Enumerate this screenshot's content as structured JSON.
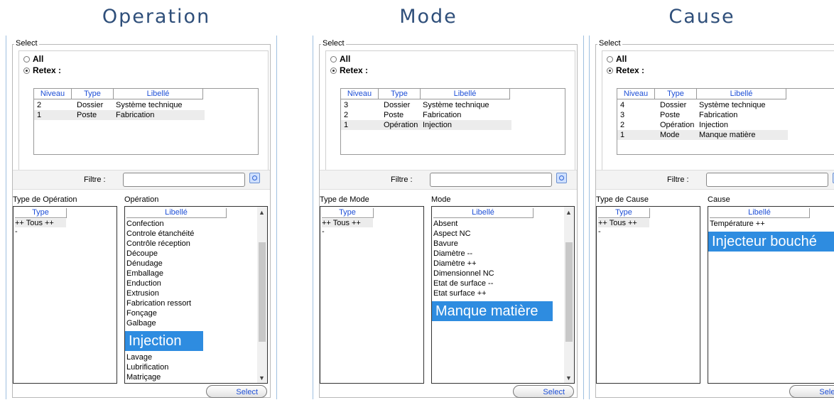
{
  "headings": [
    "Operation",
    "Mode",
    "Cause"
  ],
  "panels": [
    {
      "select_legend": "Select",
      "radio_all": "All",
      "radio_retex": "Retex :",
      "list_columns": [
        "Niveau",
        "Type",
        "Libellé"
      ],
      "list_rows": [
        {
          "niveau": "2",
          "type": "Dossier",
          "libelle": "Système technique"
        },
        {
          "niveau": "1",
          "type": "Poste",
          "libelle": "Fabrication"
        }
      ],
      "filter_label": "Filtre :",
      "type_label": "Type de Opération",
      "main_label": "Opération",
      "type_col": "Type",
      "type_items": [
        "++ Tous ++",
        "-"
      ],
      "main_col": "Libellé",
      "main_items": [
        "Confection",
        "Controle étanchéité",
        "Contrôle réception",
        "Découpe",
        "Dénudage",
        "Emballage",
        "Enduction",
        "Extrusion",
        "Fabrication ressort",
        "Fonçage",
        "Galbage"
      ],
      "highlight": "Injection",
      "after_items": [
        "Lavage",
        "Lubrification",
        "Matriçage"
      ],
      "select_button": "Select"
    },
    {
      "select_legend": "Select",
      "radio_all": "All",
      "radio_retex": "Retex :",
      "list_columns": [
        "Niveau",
        "Type",
        "Libellé"
      ],
      "list_rows": [
        {
          "niveau": "3",
          "type": "Dossier",
          "libelle": "Système technique"
        },
        {
          "niveau": "2",
          "type": "Poste",
          "libelle": "Fabrication"
        },
        {
          "niveau": "1",
          "type": "Opération",
          "libelle": "Injection"
        }
      ],
      "filter_label": "Filtre :",
      "type_label": "Type de Mode",
      "main_label": "Mode",
      "type_col": "Type",
      "type_items": [
        "++ Tous ++",
        "-"
      ],
      "main_col": "Libellé",
      "main_items": [
        "Absent",
        "Aspect NC",
        "Bavure",
        "Diamètre --",
        "Diamètre ++",
        "Dimensionnel NC",
        "Etat de surface --",
        "Etat surface ++"
      ],
      "highlight": "Manque matière",
      "after_items": [],
      "select_button": "Select"
    },
    {
      "select_legend": "Select",
      "radio_all": "All",
      "radio_retex": "Retex :",
      "list_columns": [
        "Niveau",
        "Type",
        "Libellé"
      ],
      "list_rows": [
        {
          "niveau": "4",
          "type": "Dossier",
          "libelle": "Système technique"
        },
        {
          "niveau": "3",
          "type": "Poste",
          "libelle": "Fabrication"
        },
        {
          "niveau": "2",
          "type": "Opération",
          "libelle": "Injection"
        },
        {
          "niveau": "1",
          "type": "Mode",
          "libelle": "Manque matière"
        }
      ],
      "filter_label": "Filtre :",
      "type_label": "Type de Cause",
      "main_label": "Cause",
      "type_col": "Type",
      "type_items": [
        "++ Tous ++",
        "-"
      ],
      "main_col": "Libellé",
      "main_items": [
        "Température ++"
      ],
      "highlight": "Injecteur bouché",
      "after_items": [],
      "select_button": "Select"
    }
  ]
}
